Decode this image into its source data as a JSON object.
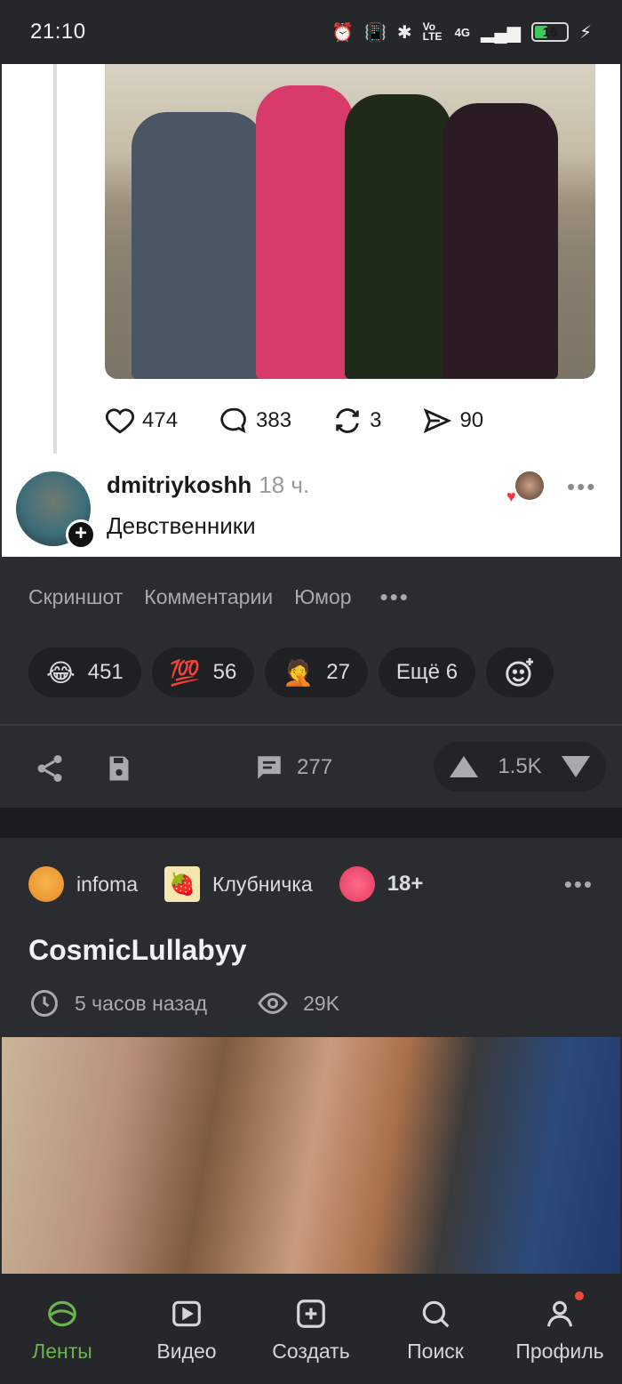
{
  "status_bar": {
    "time": "21:10",
    "battery": "16",
    "network": "4G",
    "volte": "Vo LTE"
  },
  "embedded_post": {
    "stats": {
      "likes": "474",
      "comments": "383",
      "reposts": "3",
      "shares": "90"
    },
    "author": "dmitriykoshh",
    "time": "18 ч.",
    "text": "Девственники"
  },
  "post1": {
    "tags": [
      "Скриншот",
      "Комментарии",
      "Юмор"
    ],
    "reactions": [
      {
        "icon": "laughing-face-icon",
        "emoji": "😂",
        "count": "451"
      },
      {
        "icon": "hundred-points-icon",
        "emoji": "💯",
        "count": "56"
      },
      {
        "icon": "face-palm-icon",
        "emoji": "🤦",
        "count": "27"
      }
    ],
    "more_reactions": "Ещё 6",
    "comments_count": "277",
    "rating": "1.5K"
  },
  "post2": {
    "community": "infoma",
    "tag": "Клубничка",
    "tag_icon": "strawberry-icon",
    "age_label": "18+",
    "title": "CosmicLullabyy",
    "time": "5 часов назад",
    "views": "29K"
  },
  "bottom_nav": [
    {
      "label": "Ленты",
      "icon": "feeds-icon",
      "active": true
    },
    {
      "label": "Видео",
      "icon": "video-icon",
      "active": false
    },
    {
      "label": "Создать",
      "icon": "create-icon",
      "active": false
    },
    {
      "label": "Поиск",
      "icon": "search-icon",
      "active": false
    },
    {
      "label": "Профиль",
      "icon": "profile-icon",
      "active": false
    }
  ],
  "colors": {
    "background": "#2b2c2f",
    "accent_active": "#6bb34b",
    "notification_dot": "#e84a3c"
  }
}
